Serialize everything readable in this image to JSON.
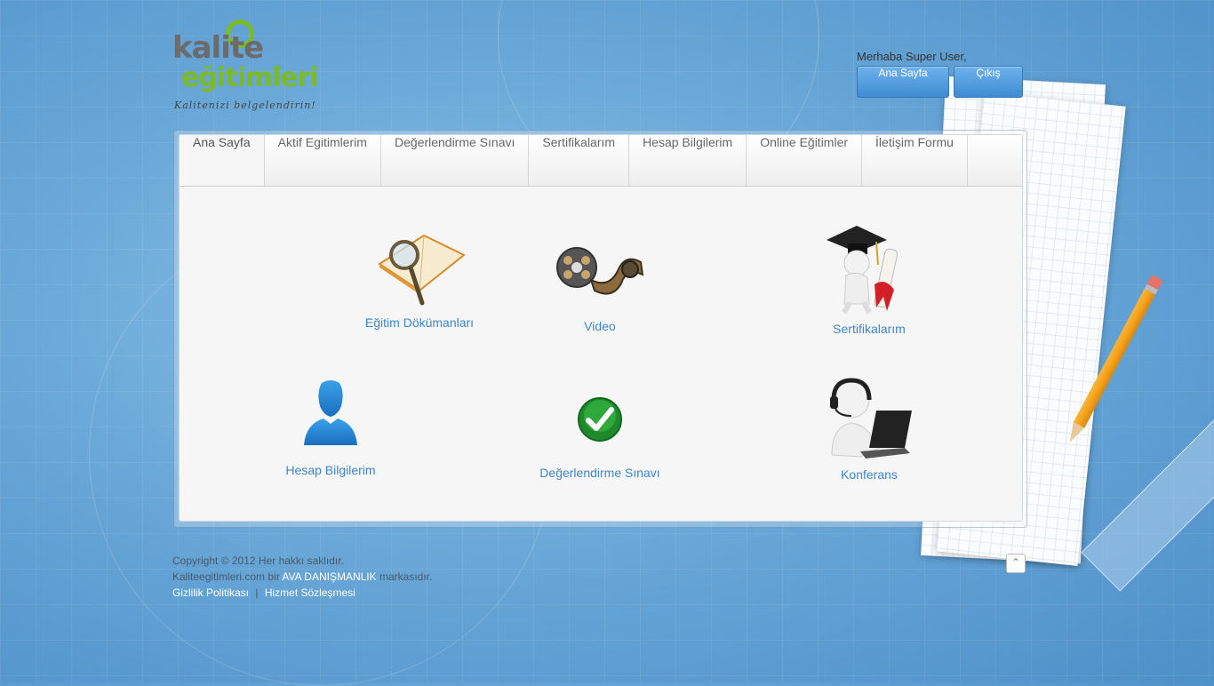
{
  "logo": {
    "line1": "kalite",
    "line2": "eğitimleri",
    "tagline": "Kalitenizi belgelendirin!"
  },
  "header": {
    "greeting": "Merhaba Super User,",
    "home_button": "Ana Sayfa",
    "logout_button": "Çıkış"
  },
  "tabs": [
    {
      "label": "Ana Sayfa",
      "active": true
    },
    {
      "label": "Aktif Egitimlerim",
      "active": false
    },
    {
      "label": "Değerlendirme Sınavı",
      "active": false
    },
    {
      "label": "Sertifikalarım",
      "active": false
    },
    {
      "label": "Hesap Bilgilerim",
      "active": false
    },
    {
      "label": "Online Eğitimler",
      "active": false
    },
    {
      "label": "İletişim Formu",
      "active": false
    }
  ],
  "tiles": [
    {
      "label": "Eğitim Dökümanları",
      "icon": "book-magnifier-icon"
    },
    {
      "label": "Video",
      "icon": "film-reel-icon"
    },
    {
      "label": "Sertifikalarım",
      "icon": "graduate-diploma-icon"
    },
    {
      "label": "Hesap Bilgilerim",
      "icon": "user-silhouette-icon"
    },
    {
      "label": "Değerlendirme Sınavı",
      "icon": "green-check-icon"
    },
    {
      "label": "Konferans",
      "icon": "headset-laptop-icon"
    }
  ],
  "footer": {
    "copyright": "Copyright © 2012 Her hakkı saklıdır.",
    "brand_prefix": "Kaliteegitimleri.com bir",
    "brand_name": "AVA DANIŞMANLIK",
    "brand_suffix": "markasıdır.",
    "privacy": "Gizlilik Politikası",
    "separator": "|",
    "terms": "Hizmet Sözleşmesi"
  },
  "colors": {
    "accent": "#3f86c4",
    "logo_green": "#7cba28",
    "button": "#4a93d6"
  }
}
